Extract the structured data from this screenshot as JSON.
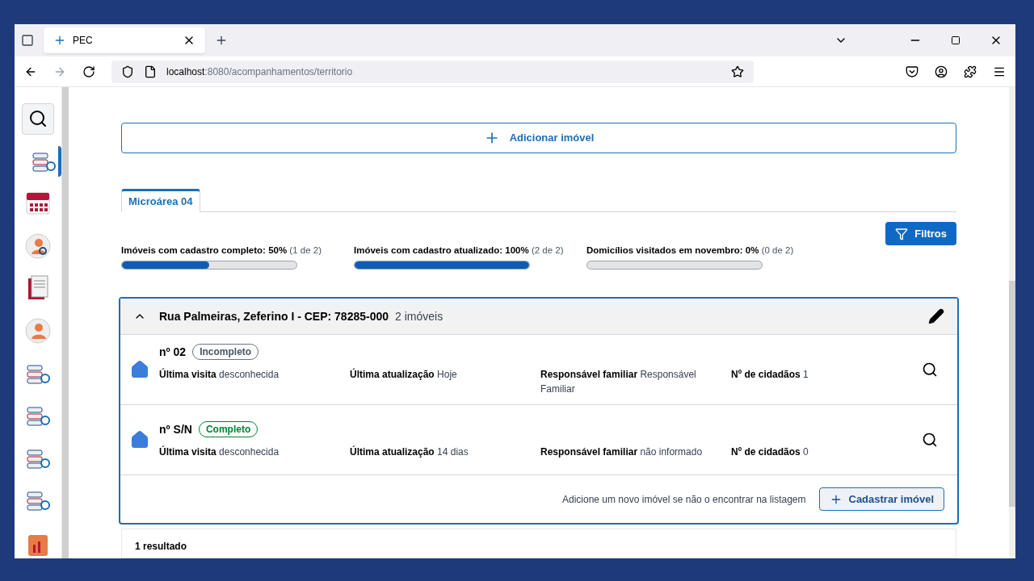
{
  "browser": {
    "tab_title": "PEC",
    "url_host": "localhost",
    "url_path": ":8080/acompanhamentos/territorio"
  },
  "sidebar": {
    "items": [
      {
        "selected": false
      },
      {
        "selected": true
      },
      {
        "selected": false
      },
      {
        "selected": false
      },
      {
        "selected": false
      },
      {
        "selected": false
      },
      {
        "selected": false
      },
      {
        "selected": false
      },
      {
        "selected": false
      },
      {
        "selected": false
      },
      {
        "selected": false
      }
    ]
  },
  "add_button": "Adicionar imóvel",
  "tabs": [
    {
      "label": "Microárea 04",
      "selected": true
    }
  ],
  "filters_button": "Filtros",
  "stats": [
    {
      "label": "Imóveis com cadastro completo: 50%",
      "count": "(1 de 2)",
      "level": 0.5
    },
    {
      "label": "Imóveis com cadastro atualizado: 100%",
      "count": "(2 de 2)",
      "level": 1
    },
    {
      "label": "Domicílios visitados em novembro: 0%",
      "count": "(0 de 2)",
      "level": 0
    }
  ],
  "street": {
    "title": "Rua Palmeiras, Zeferino I - CEP: 78285-000",
    "count": "2 imóveis",
    "expanded": true,
    "properties": [
      {
        "number": "nº 02",
        "status": {
          "label": "Incompleto",
          "kind": "incomplete"
        },
        "fields": [
          {
            "label": "Última visita",
            "value": "desconhecida"
          },
          {
            "label": "Última atualização",
            "value": "Hoje"
          },
          {
            "label": "Responsável familiar",
            "value": "Responsável Familiar"
          },
          {
            "label": "Nº de cidadãos",
            "value": "1"
          }
        ]
      },
      {
        "number": "nº S/N",
        "status": {
          "label": "Completo",
          "kind": "complete"
        },
        "fields": [
          {
            "label": "Última visita",
            "value": "desconhecida"
          },
          {
            "label": "Última atualização",
            "value": "14 dias"
          },
          {
            "label": "Responsável familiar",
            "value": "não informado"
          },
          {
            "label": "Nº de cidadãos",
            "value": "0"
          }
        ]
      }
    ],
    "footer_hint": "Adicione um novo imóvel se não o encontrar na listagem",
    "register_button": "Cadastrar imóvel"
  },
  "results": "1 resultado"
}
